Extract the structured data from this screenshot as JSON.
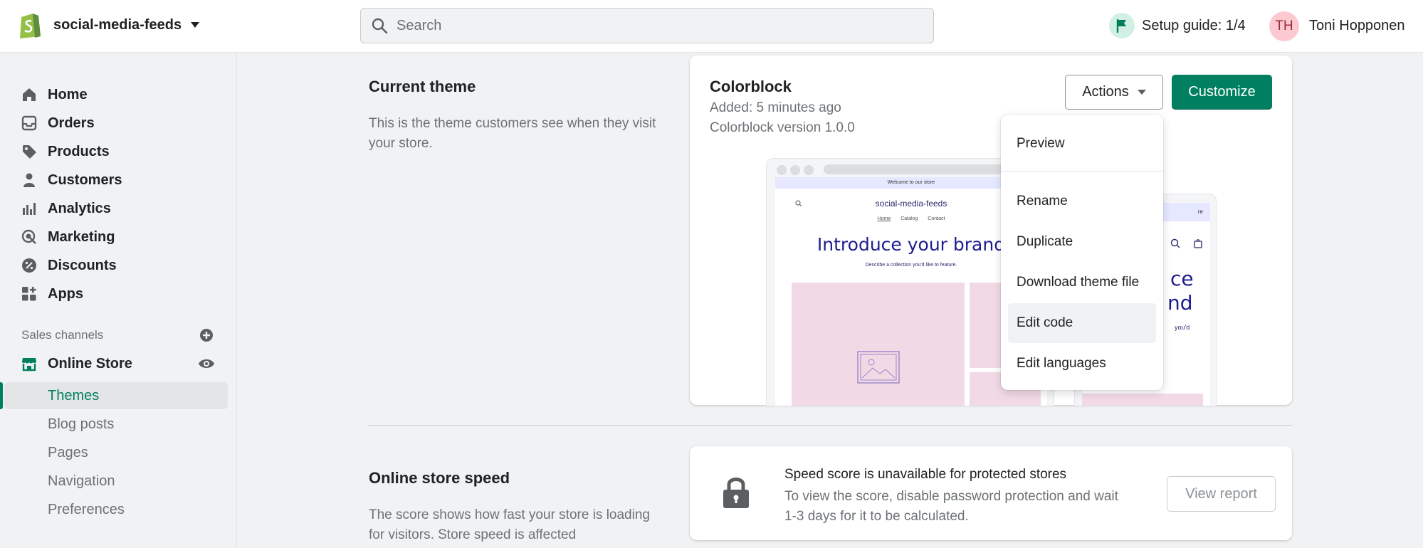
{
  "topbar": {
    "store_name": "social-media-feeds",
    "search_placeholder": "Search",
    "setup_guide": "Setup guide: 1/4",
    "avatar_initials": "TH",
    "user_name": "Toni Hopponen"
  },
  "sidebar": {
    "items": [
      {
        "label": "Home",
        "icon": "home-icon"
      },
      {
        "label": "Orders",
        "icon": "orders-icon"
      },
      {
        "label": "Products",
        "icon": "tag-icon"
      },
      {
        "label": "Customers",
        "icon": "person-icon"
      },
      {
        "label": "Analytics",
        "icon": "bar-chart-icon"
      },
      {
        "label": "Marketing",
        "icon": "target-icon"
      },
      {
        "label": "Discounts",
        "icon": "discount-icon"
      },
      {
        "label": "Apps",
        "icon": "apps-icon"
      }
    ],
    "sales_channels_title": "Sales channels",
    "online_store": "Online Store",
    "sub_items": [
      "Themes",
      "Blog posts",
      "Pages",
      "Navigation",
      "Preferences"
    ]
  },
  "current_theme": {
    "heading": "Current theme",
    "description": "This is the theme customers see when they visit your store.",
    "theme_name": "Colorblock",
    "added": "Added: 5 minutes ago",
    "version": "Colorblock version 1.0.0",
    "actions_label": "Actions",
    "customize_label": "Customize"
  },
  "preview": {
    "announcement": "Welcome to our store",
    "store_name": "social-media-feeds",
    "nav": [
      "Home",
      "Catalog",
      "Contact"
    ],
    "hero_title": "Introduce your brand",
    "hero_sub": "Describe a collection you'd like to feature.",
    "mobile_announce": "re",
    "mobile_hero_1": "ce",
    "mobile_hero_2": "nd",
    "mobile_sub": "you'd"
  },
  "actions_menu": {
    "items": [
      "Preview",
      "Rename",
      "Duplicate",
      "Download theme file",
      "Edit code",
      "Edit languages"
    ],
    "hovered": "Edit code"
  },
  "speed": {
    "heading": "Online store speed",
    "description": "The score shows how fast your store is loading for visitors. Store speed is affected",
    "title": "Speed score is unavailable for protected stores",
    "body": "To view the score, disable password protection and wait 1-3 days for it to be calculated.",
    "view_report": "View report"
  },
  "colors": {
    "primary": "#008060",
    "active_text": "#007f5f"
  }
}
